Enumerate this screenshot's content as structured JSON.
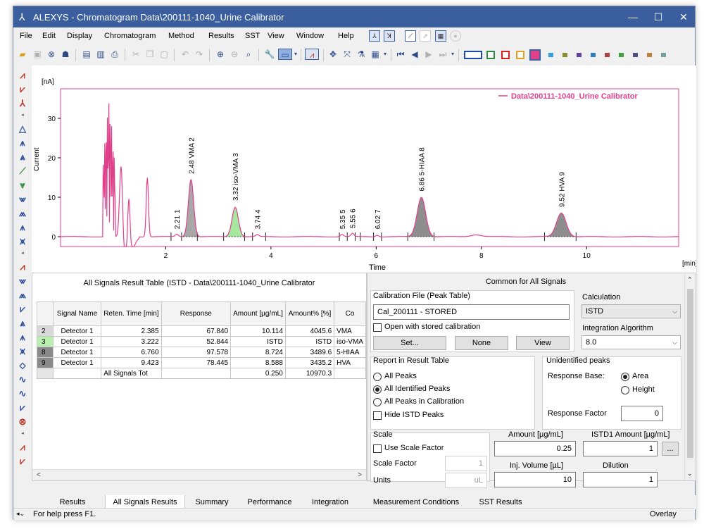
{
  "window": {
    "title": "ALEXYS - Chromatogram  Data\\200111-1040_Urine Calibrator"
  },
  "menu": [
    "File",
    "Edit",
    "Display",
    "Chromatogram",
    "Method",
    "Results",
    "SST",
    "View",
    "Window",
    "Help"
  ],
  "chart": {
    "y_unit": "[nA]",
    "y_label": "Current",
    "x_label": "Time",
    "x_unit": "[min]",
    "legend": "Data\\200111-1040_Urine Calibrator",
    "y_ticks": [
      "30",
      "20",
      "10",
      "0"
    ],
    "x_ticks": [
      "2",
      "4",
      "6",
      "8",
      "10"
    ],
    "peak_labels": [
      {
        "text": "2.21  1",
        "color": "#000"
      },
      {
        "text": "2.48 VMA  2",
        "color": "#000"
      },
      {
        "text": "3.32 iso-VMA  3",
        "color": "#000"
      },
      {
        "text": "3.74  4",
        "color": "#000"
      },
      {
        "text": "5.35  5",
        "color": "#000"
      },
      {
        "text": "5.55  6",
        "color": "#000"
      },
      {
        "text": "6.02  7",
        "color": "#000"
      },
      {
        "text": "6.86 5-HIAA  8",
        "color": "#000"
      },
      {
        "text": "9.52 HVA  9",
        "color": "#000"
      }
    ],
    "trace_color": "#e0408a"
  },
  "result_table": {
    "title": "All Signals Result Table (ISTD - Data\\200111-1040_Urine Calibrator",
    "headers": [
      "Signal Name",
      "Reten. Time [min]",
      "Response",
      "Amount [µg/mL]",
      "Amount% [%]",
      "Co"
    ],
    "rows": [
      {
        "idx": "2",
        "signal": "Detector 1",
        "rt": "2.385",
        "resp": "67.840",
        "amt": "10.114",
        "pct": "4045.6",
        "comp": "VMA",
        "color": "#d9d9d9"
      },
      {
        "idx": "3",
        "signal": "Detector 1",
        "rt": "3.222",
        "resp": "52.844",
        "amt": "ISTD",
        "pct": "ISTD",
        "comp": "iso-VMA",
        "color": "#b9f0b0"
      },
      {
        "idx": "8",
        "signal": "Detector 1",
        "rt": "6.760",
        "resp": "97.578",
        "amt": "8.724",
        "pct": "3489.6",
        "comp": "5-HIAA",
        "color": "#8a8a8a"
      },
      {
        "idx": "9",
        "signal": "Detector 1",
        "rt": "9.423",
        "resp": "78.445",
        "amt": "8.588",
        "pct": "3435.2",
        "comp": "HVA",
        "color": "#8a8a8a"
      }
    ],
    "total": {
      "label": "All Signals Tot",
      "amt": "0.250",
      "pct": "10970.3"
    }
  },
  "common": {
    "title": "Common for All Signals",
    "cal_file_label": "Calibration File (Peak Table)",
    "cal_file_value": "Cal_200111 - STORED",
    "open_stored": "Open with stored calibration",
    "set_btn": "Set...",
    "none_btn": "None",
    "view_btn": "View",
    "calc_label": "Calculation",
    "calc_value": "ISTD",
    "integ_label": "Integration Algorithm",
    "integ_value": "8.0",
    "report_label": "Report in Result Table",
    "all_peaks": "All Peaks",
    "all_identified": "All Identified Peaks",
    "all_in_cal": "All Peaks in Calibration",
    "hide_istd": "Hide ISTD Peaks",
    "unident_label": "Unidentified peaks",
    "resp_base": "Response Base:",
    "area": "Area",
    "height": "Height",
    "resp_factor": "Response Factor",
    "resp_factor_val": "0",
    "scale_label": "Scale",
    "use_scale": "Use Scale Factor",
    "scale_factor": "Scale Factor",
    "scale_factor_val": "1",
    "units": "Units",
    "units_val": "uL",
    "amount_label": "Amount [µg/mL]",
    "amount_val": "0.25",
    "istd_label": "ISTD1 Amount [µg/mL]",
    "istd_val": "1",
    "inj_label": "Inj. Volume [µL]",
    "inj_val": "10",
    "dil_label": "Dilution",
    "dil_val": "1"
  },
  "tabs": [
    "Results",
    "All Signals Results",
    "Summary",
    "Performance",
    "Integration",
    "Measurement Conditions",
    "SST Results"
  ],
  "status": {
    "help": "For help press F1.",
    "mode": "Overlay"
  }
}
